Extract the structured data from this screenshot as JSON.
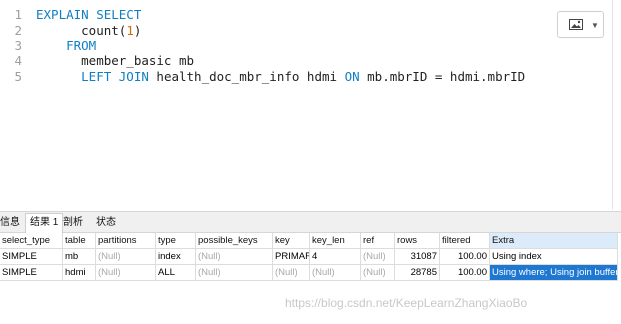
{
  "editor": {
    "lines": [
      {
        "n": "1",
        "tokens": [
          {
            "t": "EXPLAIN SELECT",
            "c": "kw"
          }
        ]
      },
      {
        "n": "2",
        "tokens": [
          {
            "t": "      count(",
            "c": "plain"
          },
          {
            "t": "1",
            "c": "num"
          },
          {
            "t": ")",
            "c": "plain"
          }
        ]
      },
      {
        "n": "3",
        "tokens": [
          {
            "t": "    FROM",
            "c": "kw"
          }
        ]
      },
      {
        "n": "4",
        "tokens": [
          {
            "t": "      member_basic mb",
            "c": "plain"
          }
        ]
      },
      {
        "n": "5",
        "tokens": [
          {
            "t": "      LEFT JOIN",
            "c": "kw"
          },
          {
            "t": " health_doc_mbr_info hdmi ",
            "c": "plain"
          },
          {
            "t": "ON",
            "c": "kw"
          },
          {
            "t": " mb.mbrID = hdmi.mbrID",
            "c": "plain"
          }
        ]
      }
    ]
  },
  "toolbar": {
    "image_icon": "image-icon",
    "dropdown_icon": "chevron-down-icon"
  },
  "tabs": [
    {
      "label": "信息",
      "active": false
    },
    {
      "label": "结果 1",
      "active": true
    },
    {
      "label": "剖析",
      "active": false
    },
    {
      "label": "状态",
      "active": false
    }
  ],
  "table": {
    "columns": [
      "select_type",
      "table",
      "partitions",
      "type",
      "possible_keys",
      "key",
      "key_len",
      "ref",
      "rows",
      "filtered",
      "Extra"
    ],
    "rows": [
      [
        "SIMPLE",
        "mb",
        "(Null)",
        "index",
        "(Null)",
        "PRIMARY",
        "4",
        "(Null)",
        "31087",
        "100.00",
        "Using index"
      ],
      [
        "SIMPLE",
        "hdmi",
        "(Null)",
        "ALL",
        "(Null)",
        "(Null)",
        "(Null)",
        "(Null)",
        "28785",
        "100.00",
        "Using where; Using join buffer"
      ]
    ]
  },
  "watermark": "https://blog.csdn.net/KeepLearnZhangXiaoBo",
  "colors": {
    "keyword": "#0f7fc4",
    "number": "#d96a00",
    "selection": "#1e78d2"
  }
}
